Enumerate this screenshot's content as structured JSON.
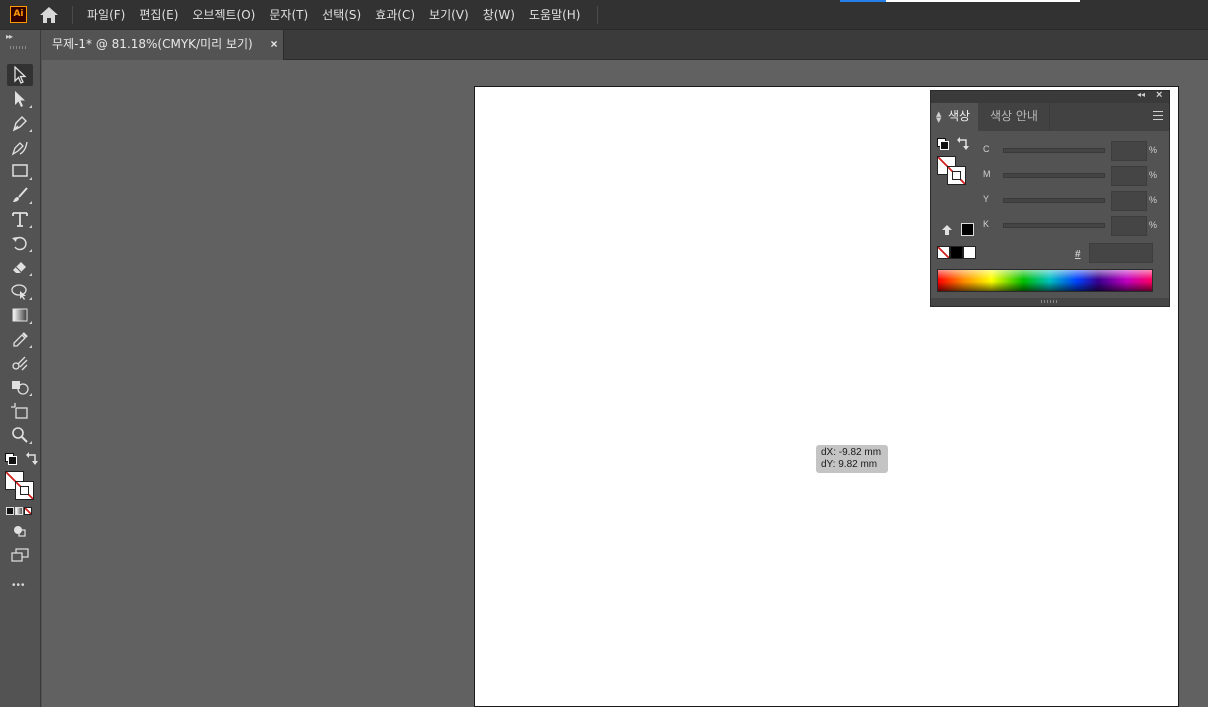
{
  "app": {
    "logo_text": "Ai",
    "accent_color": "#ff9a00"
  },
  "menu": {
    "items": [
      "파일(F)",
      "편집(E)",
      "오브젝트(O)",
      "문자(T)",
      "선택(S)",
      "효과(C)",
      "보기(V)",
      "창(W)",
      "도움말(H)"
    ]
  },
  "document_tab": {
    "label": "무제-1* @ 81.18%(CMYK/미리 보기)",
    "close": "×"
  },
  "tooltip": {
    "dx": "dX: -9.82 mm",
    "dy": "dY: 9.82 mm"
  },
  "color_panel": {
    "tab_active": "색상",
    "tab_inactive": "색상 안내",
    "channels": [
      {
        "label": "C",
        "unit": "%"
      },
      {
        "label": "M",
        "unit": "%"
      },
      {
        "label": "Y",
        "unit": "%"
      },
      {
        "label": "K",
        "unit": "%"
      }
    ],
    "hex_label": "#"
  },
  "toolbar": {
    "tools": [
      "selection-tool",
      "direct-selection-tool",
      "pen-tool",
      "curvature-tool",
      "rectangle-tool",
      "paintbrush-tool",
      "type-tool",
      "rotate-tool",
      "eraser-tool",
      "warp-tool",
      "gradient-tool",
      "eyedropper-tool",
      "blend-tool",
      "shape-builder-tool",
      "artboard-tool",
      "zoom-tool"
    ],
    "more": "•••"
  }
}
